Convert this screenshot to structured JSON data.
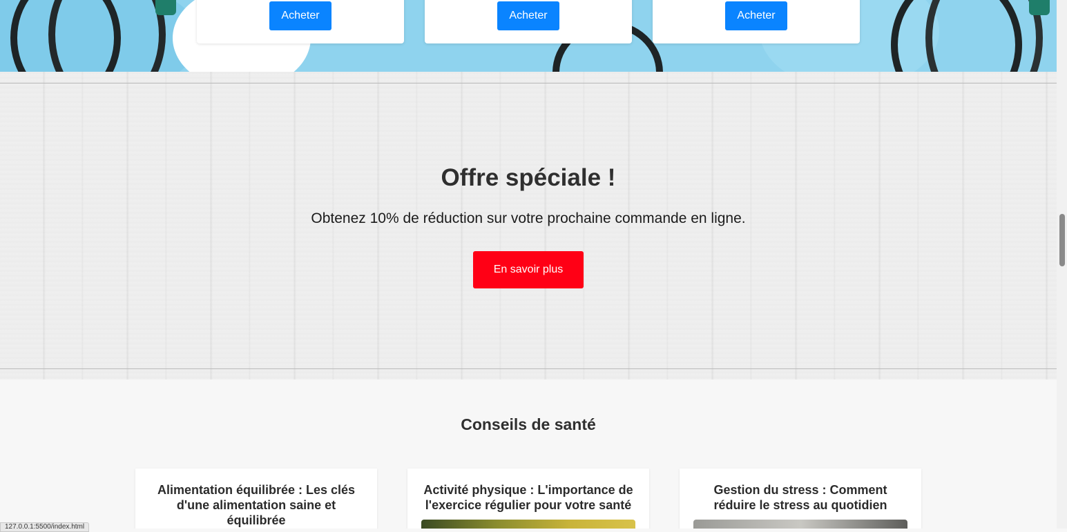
{
  "products": {
    "buy_label": "Acheter",
    "cards": [
      {
        "button": "Acheter"
      },
      {
        "button": "Acheter"
      },
      {
        "button": "Acheter"
      }
    ]
  },
  "offer": {
    "title": "Offre spéciale !",
    "text": "Obtenez 10% de réduction sur votre prochaine commande en ligne.",
    "button": "En savoir plus"
  },
  "tips": {
    "title": "Conseils de santé",
    "articles": [
      {
        "title": "Alimentation équilibrée : Les clés d'une alimentation saine et équilibrée"
      },
      {
        "title": "Activité physique : L'importance de l'exercice régulier pour votre santé"
      },
      {
        "title": "Gestion du stress : Comment réduire le stress au quotidien"
      }
    ]
  },
  "status_bar": {
    "url": "127.0.0.1:5500/index.html"
  },
  "colors": {
    "buy_button": "#0a84ff",
    "offer_button": "#ff0015",
    "hero_background": "#8fd3ee"
  }
}
